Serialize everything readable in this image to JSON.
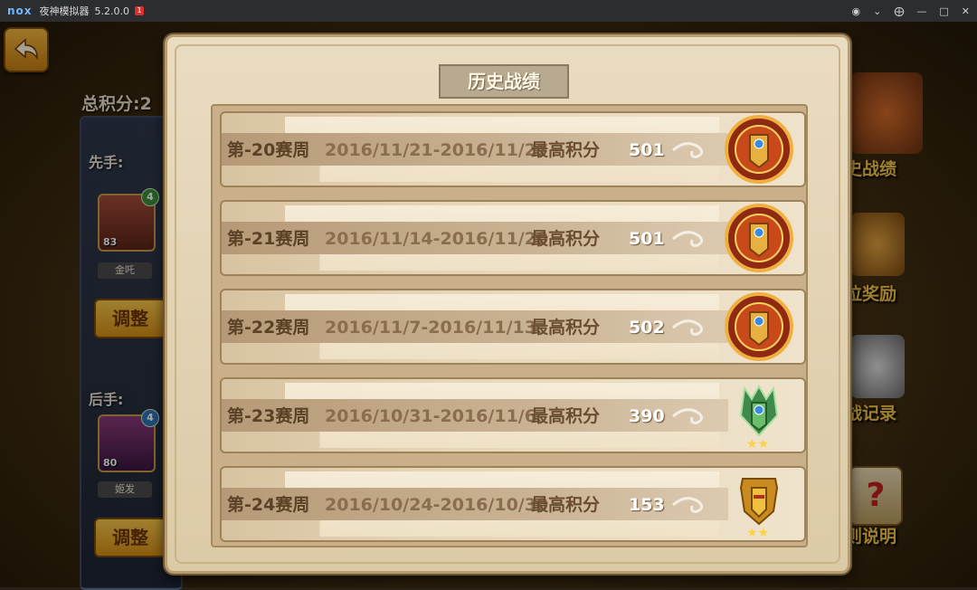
{
  "titlebar": {
    "logo": "nox",
    "app_name": "夜神模拟器",
    "version": "5.2.0.0",
    "badge": "1",
    "icons": [
      "shirt-icon",
      "chevron-down-icon",
      "pin-icon",
      "minimize-icon",
      "maximize-icon",
      "close-icon"
    ]
  },
  "left_panel": {
    "total_score_label": "总积分:2",
    "first": {
      "label": "先手:",
      "hero_name": "金吒",
      "level": "83",
      "star": "4",
      "button": "调整"
    },
    "second": {
      "label": "后手:",
      "hero_name": "姬发",
      "level": "80",
      "star": "4",
      "button": "调整"
    }
  },
  "right_menu": {
    "history": "史战绩",
    "rewards": "位奖励",
    "records": "战记录",
    "rules": "则说明"
  },
  "modal": {
    "title": "历史战绩",
    "score_label": "最高积分",
    "rows": [
      {
        "week": "第-20赛周",
        "dates": "2016/11/21-2016/11/27",
        "score": "501",
        "medal": "red-gold-medal-icon"
      },
      {
        "week": "第-21赛周",
        "dates": "2016/11/14-2016/11/20",
        "score": "501",
        "medal": "red-gold-medal-icon"
      },
      {
        "week": "第-22赛周",
        "dates": "2016/11/7-2016/11/13",
        "score": "502",
        "medal": "red-gold-medal-icon"
      },
      {
        "week": "第-23赛周",
        "dates": "2016/10/31-2016/11/6",
        "score": "390",
        "medal": "green-medal-icon"
      },
      {
        "week": "第-24赛周",
        "dates": "2016/10/24-2016/10/30",
        "score": "153",
        "medal": "gold-medal-icon"
      }
    ]
  }
}
